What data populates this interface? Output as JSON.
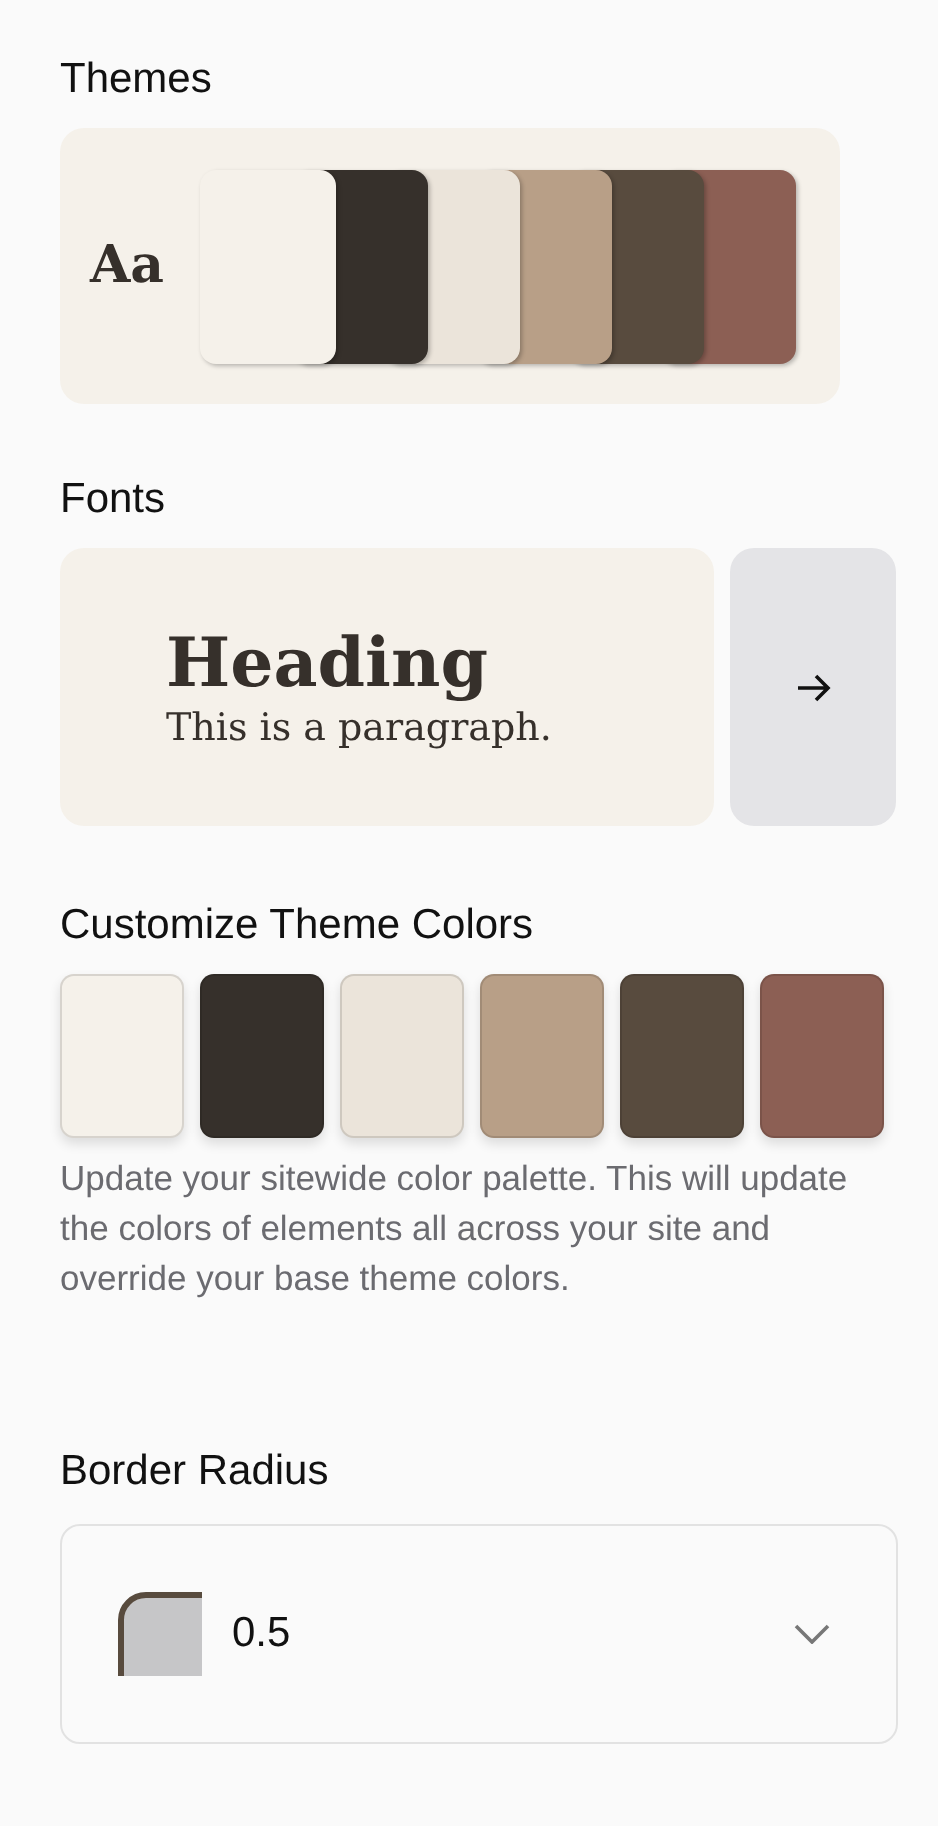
{
  "themes": {
    "title": "Themes",
    "sample": "Aa",
    "swatches": [
      {
        "color": "#f5f1ea"
      },
      {
        "color": "#36302b"
      },
      {
        "color": "#ebe4da"
      },
      {
        "color": "#b89f87"
      },
      {
        "color": "#584b3e"
      },
      {
        "color": "#8c5f54"
      }
    ]
  },
  "fonts": {
    "title": "Fonts",
    "heading": "Heading",
    "paragraph": "This is a paragraph."
  },
  "customize": {
    "title": "Customize Theme Colors",
    "swatches": [
      {
        "color": "#f5f1ea"
      },
      {
        "color": "#36302b"
      },
      {
        "color": "#ebe4da"
      },
      {
        "color": "#b89f87"
      },
      {
        "color": "#584b3e"
      },
      {
        "color": "#8c5f54"
      }
    ],
    "description": "Update your sitewide color palette. This will update the colors of elements all across your site and override your base theme colors."
  },
  "border_radius": {
    "title": "Border Radius",
    "value": "0.5"
  }
}
